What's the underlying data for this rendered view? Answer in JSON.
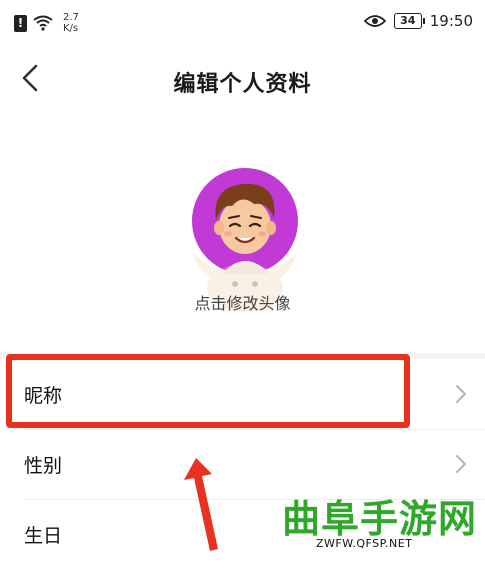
{
  "status_bar": {
    "speed_value": "2.7",
    "speed_unit": "K/s",
    "battery": "34",
    "time": "19:50"
  },
  "nav": {
    "title": "编辑个人资料"
  },
  "profile": {
    "avatar_hint": "点击修改头像",
    "avatar_bg_color": "#c23ad6"
  },
  "settings_rows": [
    {
      "label": "昵称"
    },
    {
      "label": "性别"
    },
    {
      "label": "生日"
    }
  ],
  "annotation": {
    "highlight_color": "#e8321f"
  },
  "watermark": {
    "title": "曲阜手游网",
    "url": "ZWFW.QFSP.NET",
    "color": "#2fa82a"
  }
}
